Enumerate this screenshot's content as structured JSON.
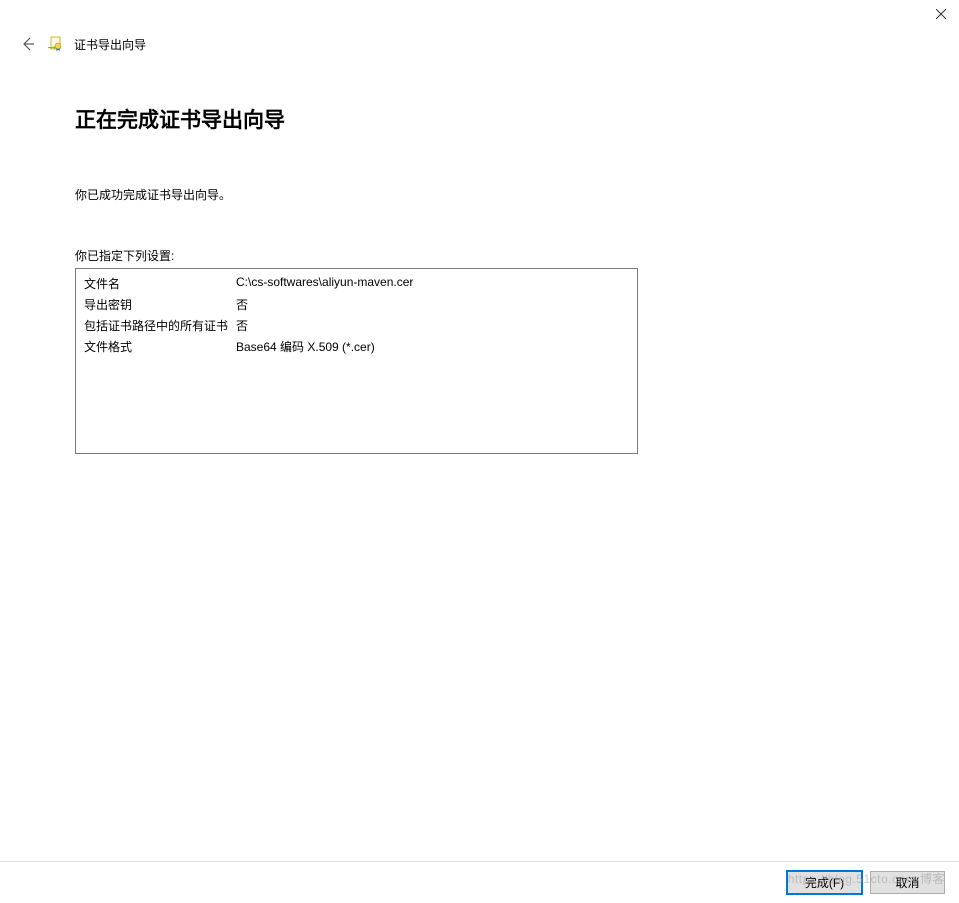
{
  "titlebar": {
    "close_label": "✕"
  },
  "header": {
    "wizard_title": "证书导出向导"
  },
  "main": {
    "heading": "正在完成证书导出向导",
    "success_text": "你已成功完成证书导出向导。",
    "settings_label": "你已指定下列设置:",
    "settings": [
      {
        "label": "文件名",
        "value": "C:\\cs-softwares\\aliyun-maven.cer"
      },
      {
        "label": "导出密钥",
        "value": "否"
      },
      {
        "label": "包括证书路径中的所有证书",
        "value": "否"
      },
      {
        "label": "文件格式",
        "value": "Base64 编码 X.509 (*.cer)"
      }
    ]
  },
  "footer": {
    "finish_label": "完成(F)",
    "cancel_label": "取消"
  },
  "watermark": "https://blog.51cto.com 博客"
}
